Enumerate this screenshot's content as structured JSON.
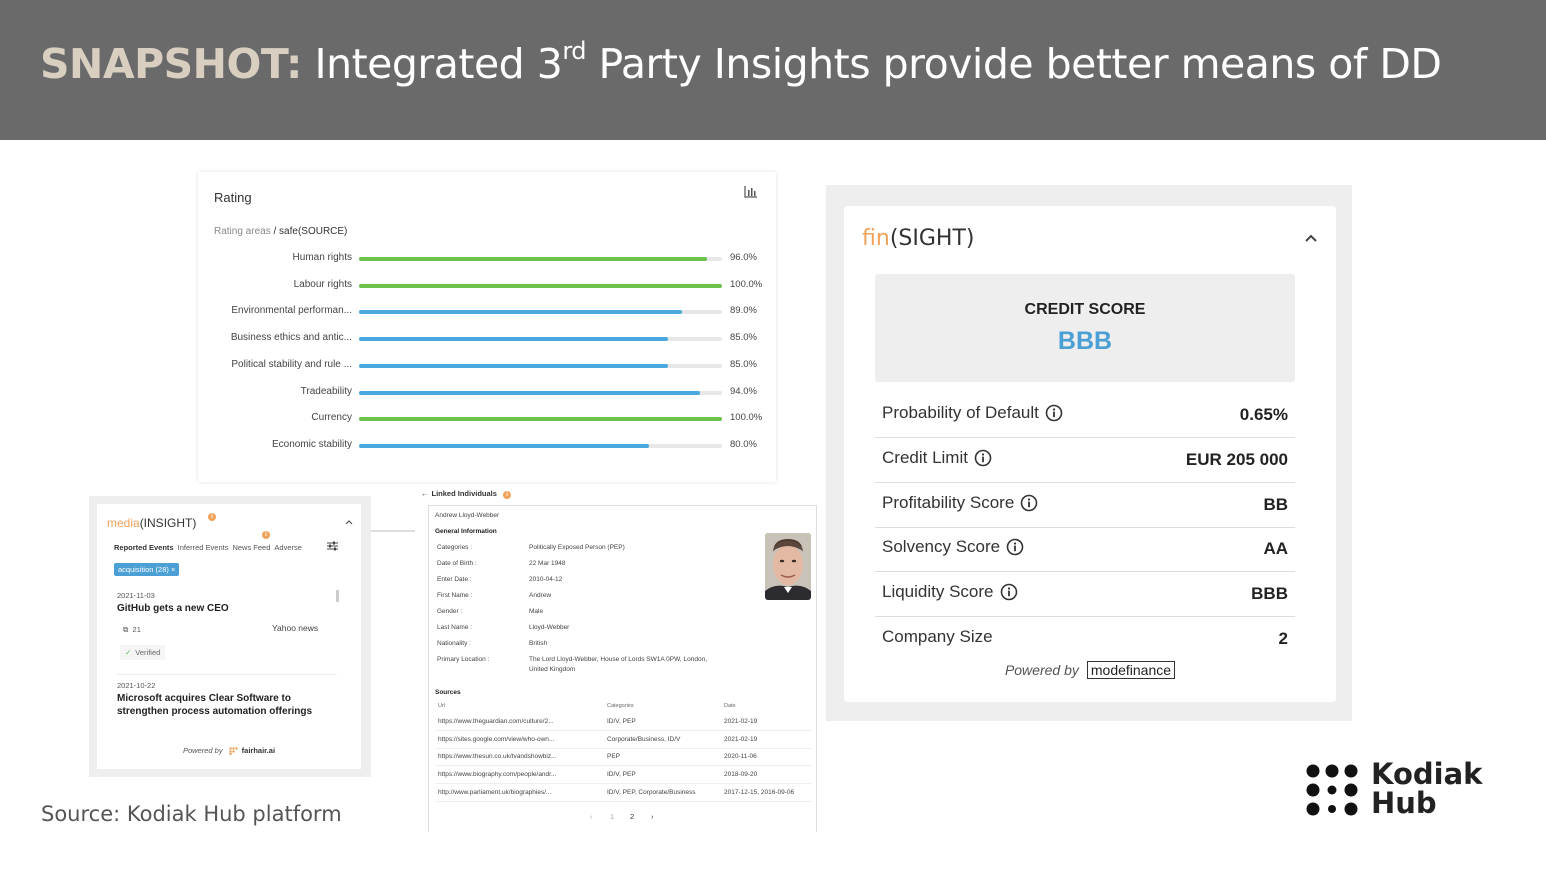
{
  "header": {
    "keyword": "SNAPSHOT:",
    "title_pre": " Integrated 3",
    "title_sup": "rd",
    "title_post": " Party Insights provide better means of DD"
  },
  "rating": {
    "title": "Rating",
    "breadcrumb_parent": "Rating areas",
    "breadcrumb_sep": " / ",
    "breadcrumb_current": "safe(SOURCE)",
    "items": [
      {
        "label": "Human rights",
        "value": 96.0,
        "display": "96.0%",
        "color": "#6cc24a"
      },
      {
        "label": "Labour rights",
        "value": 100.0,
        "display": "100.0%",
        "color": "#6cc24a"
      },
      {
        "label": "Environmental performan...",
        "value": 89.0,
        "display": "89.0%",
        "color": "#4aa8e0"
      },
      {
        "label": "Business ethics and antic...",
        "value": 85.0,
        "display": "85.0%",
        "color": "#4aa8e0"
      },
      {
        "label": "Political stability and rule ...",
        "value": 85.0,
        "display": "85.0%",
        "color": "#4aa8e0"
      },
      {
        "label": "Tradeability",
        "value": 94.0,
        "display": "94.0%",
        "color": "#4aa8e0"
      },
      {
        "label": "Currency",
        "value": 100.0,
        "display": "100.0%",
        "color": "#6cc24a"
      },
      {
        "label": "Economic stability",
        "value": 80.0,
        "display": "80.0%",
        "color": "#4aa8e0"
      }
    ]
  },
  "finsight": {
    "brand_accent": "fin",
    "brand_rest": "(SIGHT)",
    "credit_label": "CREDIT SCORE",
    "credit_value": "BBB",
    "rows": [
      {
        "label": "Probability of Default",
        "value": "0.65%",
        "info": true
      },
      {
        "label": "Credit Limit",
        "value": "EUR 205 000",
        "info": true
      },
      {
        "label": "Profitability Score",
        "value": "BB",
        "info": true
      },
      {
        "label": "Solvency Score",
        "value": "AA",
        "info": true
      },
      {
        "label": "Liquidity Score",
        "value": "BBB",
        "info": true
      },
      {
        "label": "Company Size",
        "value": "2",
        "info": false
      }
    ],
    "powered_by": "Powered by",
    "provider": "modefinance"
  },
  "media": {
    "brand_accent": "media",
    "brand_rest": "(INSIGHT)",
    "tabs": [
      "Reported Events",
      "Inferred Events",
      "News Feed",
      "Adverse"
    ],
    "chip": "acquisition (28)  ×",
    "news": [
      {
        "date": "2021-11-03",
        "title": "GitHub gets a new CEO",
        "count": "21",
        "source": "Yahoo news",
        "verified": "Verified"
      },
      {
        "date": "2021-10-22",
        "title": "Microsoft acquires Clear Software to strengthen process automation offerings"
      }
    ],
    "powered_by": "Powered by",
    "provider": "fairhair.ai"
  },
  "linked": {
    "back_label": "Linked Individuals",
    "person_name": "Andrew Lloyd-Webber",
    "section_general": "General Information",
    "fields": [
      {
        "label": "Categories :",
        "value": "Politically Exposed Person (PEP)"
      },
      {
        "label": "Date of Birth :",
        "value": "22 Mar 1948"
      },
      {
        "label": "Enter Date :",
        "value": "2010-04-12"
      },
      {
        "label": "First Name :",
        "value": "Andrew"
      },
      {
        "label": "Gender :",
        "value": "Male"
      },
      {
        "label": "Last Name :",
        "value": "Lloyd-Webber"
      },
      {
        "label": "Nationality :",
        "value": "British"
      },
      {
        "label": "Primary Location :",
        "value": "The Lord Lloyd-Webber, House of Lords SW1A 0PW, London,",
        "value2": "United Kingdom"
      }
    ],
    "sources_title": "Sources",
    "sources_headers": [
      "Url",
      "Categories",
      "Date"
    ],
    "sources": [
      {
        "url": "https://www.theguardian.com/culture/2...",
        "categories": "ID/V, PEP",
        "date": "2021-02-19"
      },
      {
        "url": "https://sites.google.com/view/who-own...",
        "categories": "Corporate/Business, ID/V",
        "date": "2021-02-19"
      },
      {
        "url": "https://www.thesun.co.uk/tvandshowbiz...",
        "categories": "PEP",
        "date": "2020-11-06"
      },
      {
        "url": "https://www.biography.com/people/andr...",
        "categories": "ID/V, PEP",
        "date": "2018-09-20"
      },
      {
        "url": "http://www.parliament.uk/biographies/...",
        "categories": "ID/V, PEP, Corporate/Business",
        "date": "2017-12-15, 2016-09-06"
      }
    ],
    "pages": [
      "‹",
      "1",
      "2",
      "›"
    ]
  },
  "footer": {
    "source_note": "Source: Kodiak Hub platform",
    "logo_line1": "Kodiak",
    "logo_line2": "Hub"
  }
}
